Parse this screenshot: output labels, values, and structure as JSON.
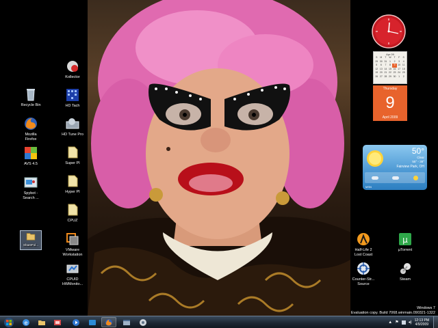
{
  "desktop_icons": {
    "recycle_bin": "Recycle Bin",
    "firefox": "Mozilla\nFirefox",
    "avs": "AVS 4.5",
    "spybot": "Spybot -\nSearch ...",
    "folder_selected": "ShareFol...",
    "kollector": "Kollector",
    "hd_tach": "HD Tach",
    "hd_tune": "HD Tune Pro",
    "super_pi": "Super PI",
    "hyper_pi": "Hyper PI",
    "cpuz": "CPUZ",
    "vmware": "VMware\nWorkstation",
    "cpuid": "CPUID\nHWMonito...",
    "half_life": "Half-Life 2\nLost Coast",
    "utorrent": "µTorrent",
    "counter_strike": "Counter-Str...\nSource",
    "steam": "Steam"
  },
  "calendar": {
    "month_header": "Apr 09",
    "weekday": "Thursday",
    "day": "9",
    "month_year": "April 2009",
    "grid": [
      [
        "S",
        "M",
        "T",
        "W",
        "T",
        "F",
        "S"
      ],
      [
        "29",
        "30",
        "31",
        "1",
        "2",
        "3",
        "4"
      ],
      [
        "5",
        "6",
        "7",
        "8",
        "9",
        "10",
        "11"
      ],
      [
        "12",
        "13",
        "14",
        "15",
        "16",
        "17",
        "18"
      ],
      [
        "19",
        "20",
        "21",
        "22",
        "23",
        "24",
        "25"
      ],
      [
        "26",
        "27",
        "28",
        "29",
        "30",
        "1",
        "2"
      ]
    ]
  },
  "weather": {
    "temp": "50°",
    "condition": "Clear",
    "range": "55° - 38°",
    "location": "Fairview Park, OH",
    "source": "MSN"
  },
  "watermark": {
    "line1": "Windows 7",
    "line2": "Evaluation copy. Build 7068.winmain.090321-1322"
  },
  "taskbar": {
    "time": "12:13 PM",
    "date": "4/9/2009"
  },
  "colors": {
    "accent": "#d2202b",
    "calendar_orange": "#e8632c",
    "weather_blue": "#2d7fc1"
  }
}
